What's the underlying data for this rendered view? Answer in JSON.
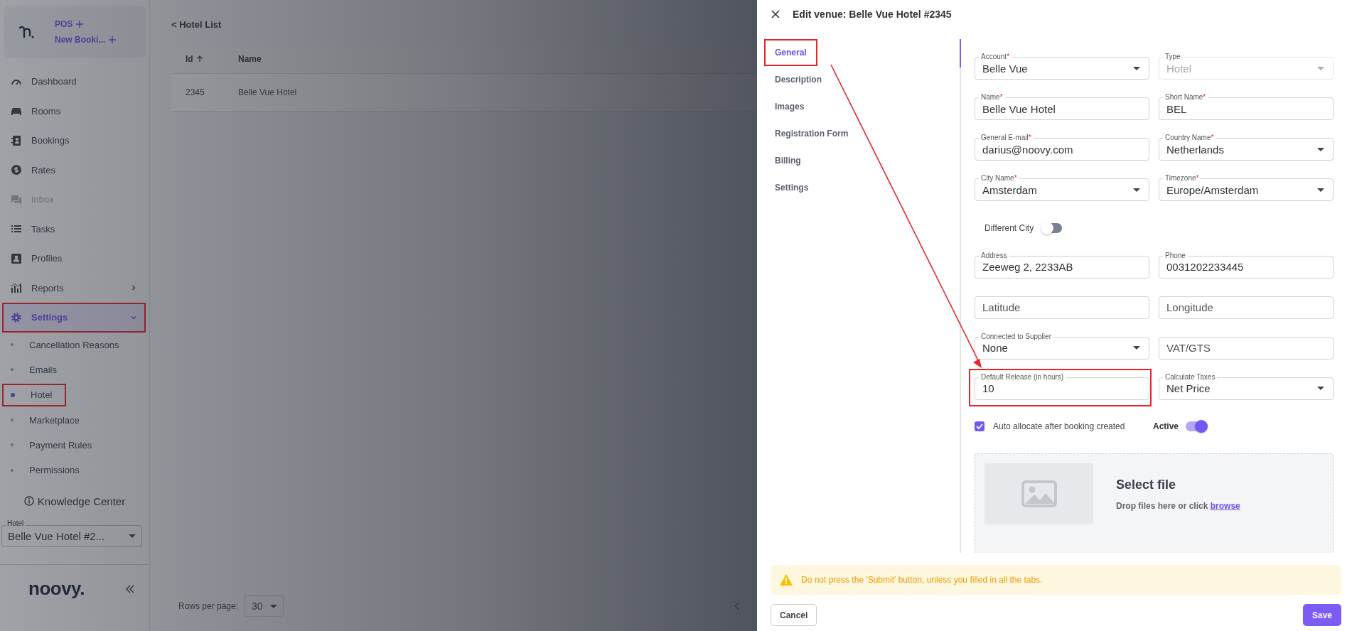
{
  "sidebar": {
    "quick_actions": [
      {
        "label": "POS"
      },
      {
        "label": "New Booki..."
      }
    ],
    "items": [
      {
        "label": "Dashboard",
        "disabled": false,
        "selected": false
      },
      {
        "label": "Rooms",
        "disabled": false,
        "selected": false
      },
      {
        "label": "Bookings",
        "disabled": false,
        "selected": false
      },
      {
        "label": "Rates",
        "disabled": false,
        "selected": false
      },
      {
        "label": "Inbox",
        "disabled": true,
        "selected": false
      },
      {
        "label": "Tasks",
        "disabled": false,
        "selected": false
      },
      {
        "label": "Profiles",
        "disabled": false,
        "selected": false
      },
      {
        "label": "Reports",
        "disabled": false,
        "selected": false,
        "expanded": false
      },
      {
        "label": "Settings",
        "disabled": false,
        "selected": true,
        "expanded": true,
        "highlighted": true,
        "children": [
          {
            "label": "Cancellation Reasons",
            "selected": false,
            "highlighted": false
          },
          {
            "label": "Emails",
            "selected": false,
            "highlighted": false
          },
          {
            "label": "Hotel",
            "selected": true,
            "highlighted": true
          },
          {
            "label": "Marketplace",
            "selected": false,
            "highlighted": false
          },
          {
            "label": "Payment Rules",
            "selected": false,
            "highlighted": false
          },
          {
            "label": "Permissions",
            "selected": false,
            "highlighted": false
          }
        ]
      }
    ],
    "knowledge_center": "Knowledge Center",
    "hotel_select": {
      "label": "Hotel",
      "value": "Belle Vue Hotel #2..."
    },
    "logo": "noovy."
  },
  "main": {
    "back_link": "< Hotel List",
    "table": {
      "columns": [
        {
          "label": "Id",
          "sorted_ascending": true
        },
        {
          "label": "Name",
          "sorted_ascending": false
        }
      ],
      "rows": [
        [
          "2345",
          "Belle Vue Hotel"
        ]
      ]
    },
    "rows_per_page": {
      "label": "Rows per page:",
      "value": "30"
    }
  },
  "drawer": {
    "title": "Edit venue: Belle Vue Hotel #2345",
    "tabs": [
      {
        "label": "General",
        "selected": true,
        "highlighted": true
      },
      {
        "label": "Description",
        "selected": false,
        "highlighted": false
      },
      {
        "label": "Images",
        "selected": false,
        "highlighted": false
      },
      {
        "label": "Registration Form",
        "selected": false,
        "highlighted": false
      },
      {
        "label": "Billing",
        "selected": false,
        "highlighted": false
      },
      {
        "label": "Settings",
        "selected": false,
        "highlighted": false
      }
    ],
    "sections": [
      {
        "kind": "fields",
        "fields": [
          {
            "kind": "select",
            "label": "Account",
            "required_mark": "*",
            "value": "Belle Vue",
            "disabled": false
          },
          {
            "kind": "select",
            "label": "Type",
            "value": "Hotel",
            "disabled": true
          },
          {
            "kind": "text",
            "label": "Name",
            "required_mark": "*",
            "value": "Belle Vue Hotel",
            "disabled": false
          },
          {
            "kind": "text",
            "label": "Short Name",
            "required_mark": "*",
            "value": "BEL",
            "disabled": false
          },
          {
            "kind": "text",
            "label": "General E-mail",
            "required_mark": "*",
            "value": "darius@noovy.com",
            "disabled": false
          },
          {
            "kind": "select",
            "label": "Country Name",
            "required_mark": "*",
            "value": "Netherlands",
            "disabled": false
          },
          {
            "kind": "select",
            "label": "City Name",
            "required_mark": "*",
            "value": "Amsterdam",
            "disabled": false
          },
          {
            "kind": "select",
            "label": "Timezone",
            "required_mark": "*",
            "value": "Europe/Amsterdam",
            "disabled": false
          }
        ]
      },
      {
        "kind": "toggle",
        "label": "Different City",
        "on": false
      },
      {
        "kind": "fields",
        "fields": [
          {
            "kind": "text",
            "label": "Address",
            "value": "Zeeweg 2, 2233AB",
            "disabled": false
          },
          {
            "kind": "text",
            "label": "Phone",
            "value": "0031202233445",
            "disabled": false
          },
          {
            "kind": "text",
            "placeholder": "Latitude",
            "disabled": false
          },
          {
            "kind": "text",
            "placeholder": "Longitude",
            "disabled": false
          },
          {
            "kind": "select",
            "label": "Connected to Supplier",
            "value": "None",
            "disabled": false
          },
          {
            "kind": "text",
            "placeholder": "VAT/GTS",
            "disabled": false
          },
          {
            "kind": "text",
            "label": "Default Release (in hours)",
            "value": "10",
            "disabled": false,
            "highlighted": true
          },
          {
            "kind": "select",
            "label": "Calculate Taxes",
            "value": "Net Price",
            "disabled": false
          }
        ]
      },
      {
        "kind": "options",
        "checkbox": {
          "label": "Auto allocate after booking created",
          "checked": true
        },
        "switch": {
          "label": "Active",
          "on": true
        }
      },
      {
        "kind": "upload",
        "title": "Select file",
        "hint": "Drop files here or click",
        "link": "browse"
      }
    ],
    "annotation_arrow": true,
    "warning": "Do not press the 'Submit' button, unless you filled in all the tabs.",
    "buttons": [
      {
        "label": "Cancel",
        "kind": "secondary"
      },
      {
        "label": "Save",
        "kind": "primary"
      }
    ]
  }
}
